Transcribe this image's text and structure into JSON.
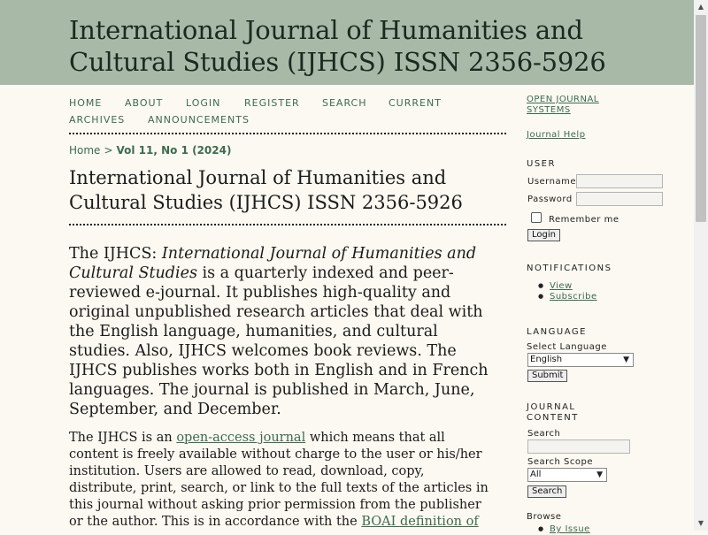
{
  "header": {
    "title": "International Journal of Humanities and Cultural Studies (IJHCS) ISSN 2356-5926"
  },
  "nav": {
    "home": "HOME",
    "about": "ABOUT",
    "login": "LOGIN",
    "register": "REGISTER",
    "search": "SEARCH",
    "current": "CURRENT",
    "archives": "ARCHIVES",
    "announcements": "ANNOUNCEMENTS"
  },
  "breadcrumb": {
    "home": "Home",
    "separator": ">",
    "current": "Vol 11, No 1 (2024)"
  },
  "main": {
    "heading": "International Journal of Humanities and Cultural Studies (IJHCS) ISSN 2356-5926",
    "intro": {
      "lead": "The IJHCS: ",
      "journal_name": "International Journal of Humanities and Cultural Studies",
      "body": " is a quarterly indexed and peer-reviewed e-journal. It publishes high-quality and original unpublished research articles that deal with the English language, humanities, and cultural studies. Also, IJHCS welcomes book reviews. The IJHCS publishes works both in English and in French languages. The journal is published in March, June, September, and  December."
    },
    "access": {
      "lead": "The IJHCS is an ",
      "link": "open-access journal",
      "body": " which means that all content is freely available without charge to the user or his/her institution. Users are allowed to read, download, copy, distribute, print, search, or link to the full texts of the articles in this journal without asking prior permission from the publisher or the author. This is in accordance with the ",
      "link2": "BOAI definition of"
    }
  },
  "sidebar": {
    "ojs_link": "OPEN JOURNAL SYSTEMS",
    "help_link": "Journal Help",
    "user": {
      "title": "USER",
      "username_label": "Username",
      "password_label": "Password",
      "remember_label": "Remember me",
      "login_button": "Login"
    },
    "notifications": {
      "title": "NOTIFICATIONS",
      "view": "View",
      "subscribe": "Subscribe"
    },
    "language": {
      "title": "LANGUAGE",
      "select_label": "Select Language",
      "selected": "English",
      "submit_button": "Submit"
    },
    "journal_content": {
      "title": "JOURNAL CONTENT",
      "search_label": "Search",
      "scope_label": "Search Scope",
      "scope_selected": "All",
      "search_button": "Search",
      "browse_label": "Browse",
      "by_issue": "By Issue"
    }
  },
  "colors": {
    "header_bg": "#a9b9a8",
    "page_bg": "#fbf9f1",
    "link": "#3d6b4f"
  },
  "icons": {
    "scroll_up": "triangle-up-icon",
    "scroll_down": "triangle-down-icon",
    "select_chevron": "chevron-down-icon"
  }
}
